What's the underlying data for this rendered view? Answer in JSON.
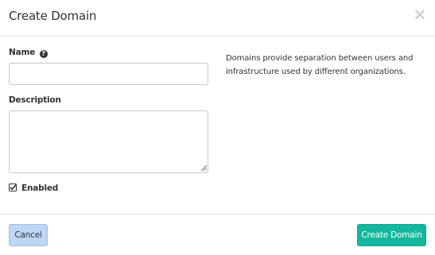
{
  "dialog": {
    "title": "Create Domain",
    "close_icon": "close-icon"
  },
  "form": {
    "name": {
      "label": "Name",
      "value": "",
      "placeholder": "",
      "help_icon": "question-circle-icon"
    },
    "description": {
      "label": "Description",
      "value": "",
      "placeholder": ""
    },
    "enabled": {
      "label": "Enabled",
      "checked": true,
      "icon": "checkbox-checked-icon"
    }
  },
  "help_text": "Domains provide separation between users and infrastructure used by different organizations.",
  "footer": {
    "cancel_label": "Cancel",
    "submit_label": "Create Domain"
  },
  "colors": {
    "primary": "#14b89c",
    "cancel": "#bcd6f5"
  }
}
